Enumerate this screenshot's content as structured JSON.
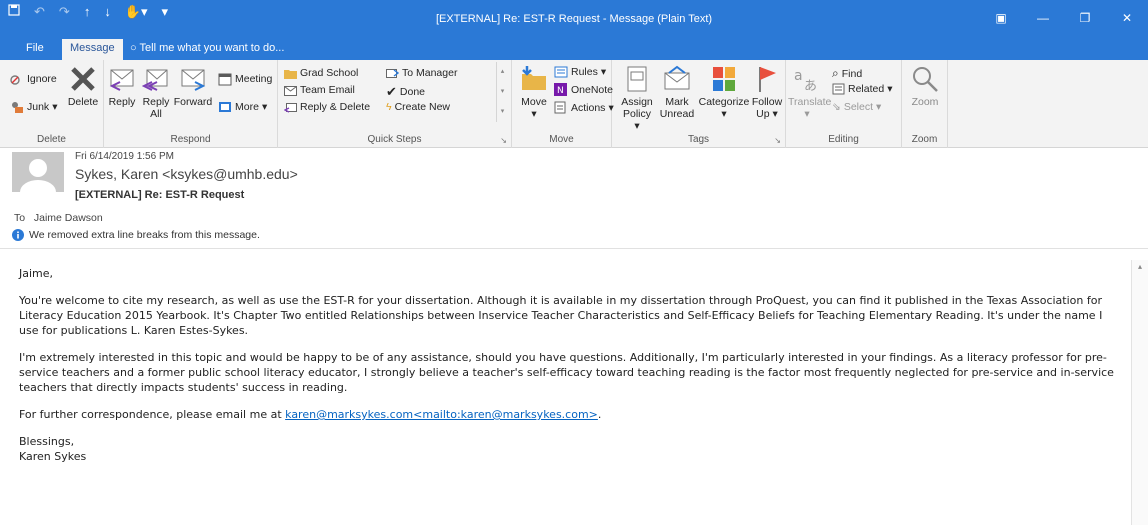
{
  "window": {
    "title": "[EXTERNAL] Re: EST-R Request  -  Message (Plain Text)",
    "qat": [
      "save-icon",
      "undo-icon",
      "redo-icon",
      "up-arrow-icon",
      "down-arrow-icon",
      "touch-mode-icon",
      "customize-icon"
    ]
  },
  "tabs": [
    {
      "label": "File"
    },
    {
      "label": "Message"
    }
  ],
  "tellme": "Tell me what you want to do...",
  "ribbon": {
    "delete": {
      "ignore": "Ignore",
      "junk": "Junk",
      "delete": "Delete",
      "label": "Delete"
    },
    "respond": {
      "reply": "Reply",
      "reply_all_1": "Reply",
      "reply_all_2": "All",
      "forward": "Forward",
      "meeting": "Meeting",
      "more": "More",
      "label": "Respond"
    },
    "quick_steps": {
      "grad_school": "Grad School",
      "team_email": "Team Email",
      "reply_delete": "Reply & Delete",
      "to_manager": "To Manager",
      "done": "Done",
      "create_new": "Create New",
      "label": "Quick Steps"
    },
    "move": {
      "move": "Move",
      "rules": "Rules",
      "onenote": "OneNote",
      "actions": "Actions",
      "label": "Move"
    },
    "tags": {
      "assign_1": "Assign",
      "assign_2": "Policy",
      "mark_1": "Mark",
      "mark_2": "Unread",
      "categorize": "Categorize",
      "follow_1": "Follow",
      "follow_2": "Up",
      "label": "Tags"
    },
    "editing": {
      "translate": "Translate",
      "find": "Find",
      "related": "Related",
      "select": "Select",
      "label": "Editing"
    },
    "zoom": {
      "zoom": "Zoom",
      "label": "Zoom"
    }
  },
  "message": {
    "date": "Fri 6/14/2019 1:56 PM",
    "sender": "Sykes, Karen <ksykes@umhb.edu>",
    "subject": "[EXTERNAL] Re: EST-R Request",
    "to_label": "To",
    "to": "Jaime Dawson",
    "info": "We removed extra line breaks from this message."
  },
  "body": {
    "greeting": "Jaime,",
    "p1": "You're welcome to cite my research,  as well as use the EST-R for your dissertation.  Although it is available in my dissertation through ProQuest, you can find it published in the Texas Association for Literacy Education 2015 Yearbook. It's Chapter Two entitled Relationships between Inservice Teacher Characteristics and Self-Efficacy Beliefs for Teaching Elementary Reading. It's under the name I use for publications L. Karen Estes-Sykes.",
    "p2": "I'm extremely interested in this topic and would be happy to be of any assistance, should you have questions.  Additionally, I'm particularly interested in your findings.  As a literacy professor for pre-service teachers and a former public school literacy educator, I strongly believe a teacher's self-efficacy toward teaching reading is the factor most frequently neglected for pre-service and in-service teachers that directly impacts students' success in reading.",
    "p3_prefix": "For further correspondence, please email me at ",
    "p3_link": "karen@marksykes.com<mailto:karen@marksykes.com>",
    "p3_suffix": ".",
    "closing": "Blessings,",
    "signature": "Karen Sykes"
  }
}
